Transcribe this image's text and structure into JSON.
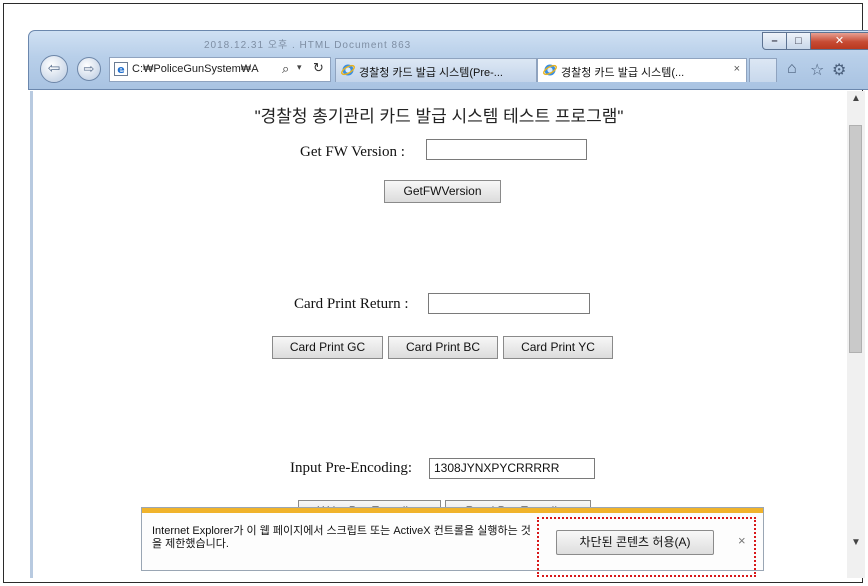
{
  "browser": {
    "ghost_title": "2018.12.31 오후 . HTML Document   863",
    "window_controls": {
      "minimize": "–",
      "maximize": "□",
      "close": "✕"
    },
    "address": {
      "text": "C:₩PoliceGunSystem₩A",
      "search_glyph": "⌕",
      "dropdown_glyph": "▾",
      "refresh_glyph": "↻"
    },
    "nav": {
      "back_glyph": "⇦",
      "forward_glyph": "⇨"
    },
    "tabs": [
      {
        "label": "경찰청 카드 발급 시스템(Pre-...",
        "active": false
      },
      {
        "label": "경찰청 카드 발급 시스템(...",
        "active": true,
        "close_glyph": "×"
      }
    ],
    "command_icons": {
      "home": "⌂",
      "favorites": "☆",
      "tools": "⚙"
    }
  },
  "page": {
    "title": "\"경찰청 총기관리 카드 발급 시스템 테스트 프로그램\"",
    "fw_version": {
      "label": "Get FW Version :",
      "value": "",
      "button": "GetFWVersion"
    },
    "card_print": {
      "label": "Card Print Return :",
      "value": "",
      "buttons": [
        "Card Print GC",
        "Card Print BC",
        "Card Print YC"
      ]
    },
    "pre_encoding": {
      "label": "Input Pre-Encoding:",
      "value": "1308JYNXPYCRRRRR",
      "write_button": "Write Pre-Encoding",
      "read_button": "Read Pre-Encoding"
    }
  },
  "scrollbar": {
    "up_glyph": "▲",
    "down_glyph": "▼"
  },
  "notification": {
    "message": "Internet Explorer가 이 웹 페이지에서 스크립트 또는 ActiveX 컨트롤을 실행하는 것을 제한했습니다.",
    "allow_button": "차단된 콘텐츠 허용(A)",
    "close_glyph": "×"
  },
  "colors": {
    "notification_bar": "#f0b32b",
    "highlight_border": "#d8181a",
    "titlebar": "#b8cfe9"
  }
}
